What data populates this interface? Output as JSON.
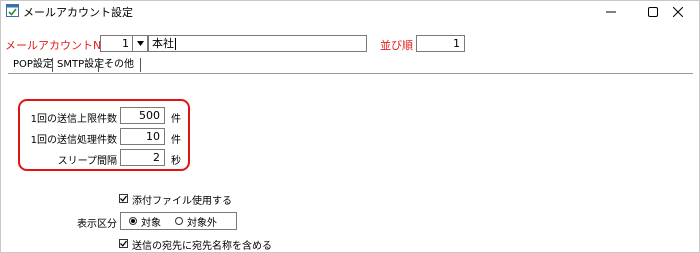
{
  "window": {
    "title": "メールアカウント設定"
  },
  "header": {
    "account_no_label": "メールアカウントNO",
    "account_no_value": "1",
    "account_name": "本社",
    "order_label": "並び順",
    "order_value": "1"
  },
  "tabs": [
    {
      "label": "POP設定"
    },
    {
      "label": "SMTP設定"
    },
    {
      "label": "その他"
    }
  ],
  "fields": {
    "send_limit": {
      "label": "1回の送信上限件数",
      "value": "500",
      "unit": "件"
    },
    "process_count": {
      "label": "1回の送信処理件数",
      "value": "10",
      "unit": "件"
    },
    "sleep_interval": {
      "label": "スリープ間隔",
      "value": "2",
      "unit": "秒"
    }
  },
  "options": {
    "use_attachment": {
      "label": "添付ファイル使用する",
      "checked": true
    },
    "display_label": "表示区分",
    "display_options": [
      {
        "label": "対象",
        "selected": true
      },
      {
        "label": "対象外",
        "selected": false
      }
    ],
    "include_recipient_name": {
      "label": "送信の宛先に宛先名称を含める",
      "checked": true
    }
  },
  "colors": {
    "accent_red": "#e0201d",
    "highlight_red": "#e11414"
  }
}
